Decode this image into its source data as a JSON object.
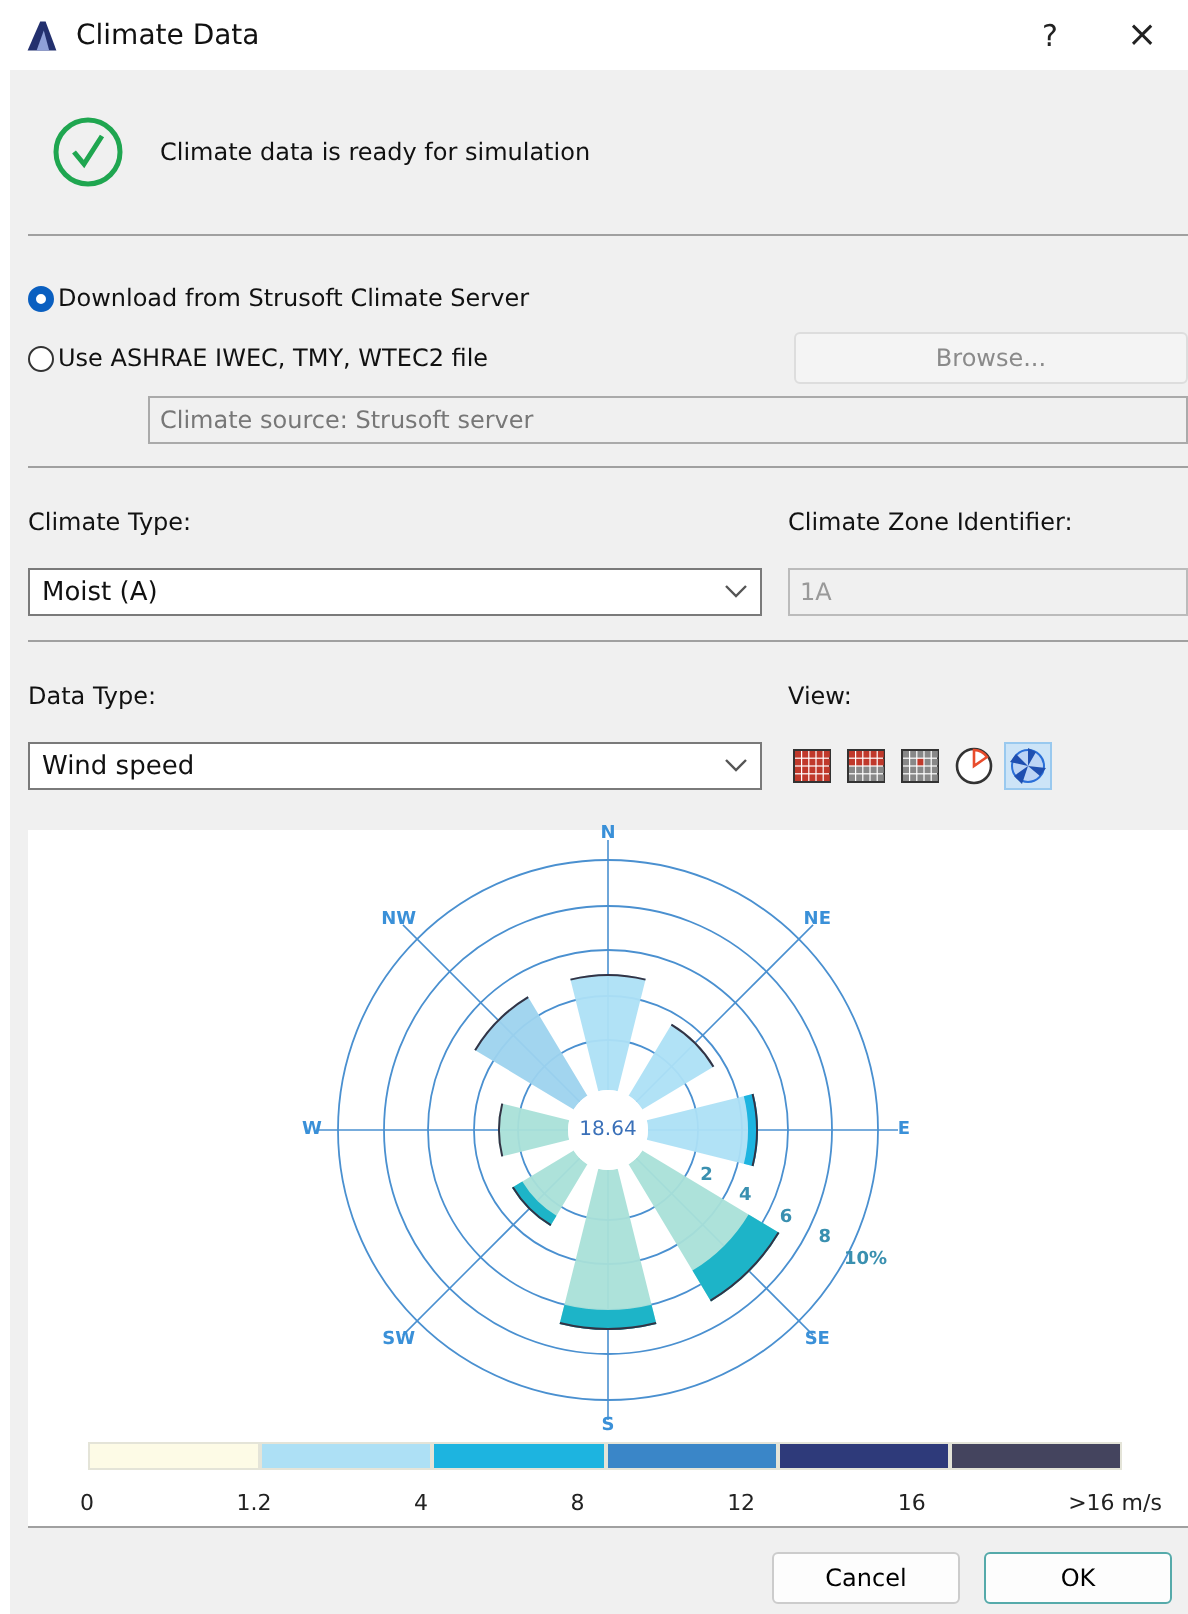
{
  "window": {
    "title": "Climate Data",
    "help": "?",
    "close": "×"
  },
  "status": {
    "message": "Climate data is ready for simulation",
    "ok": true
  },
  "source_options": [
    {
      "label": "Download from Strusoft Climate Server",
      "selected": true
    },
    {
      "label": "Use ASHRAE IWEC, TMY, WTEC2 file",
      "selected": false
    }
  ],
  "browse_button": {
    "label": "Browse...",
    "disabled": true
  },
  "source_field": {
    "value": "Climate source: Strusoft server"
  },
  "climate_type": {
    "label": "Climate Type:",
    "value": "Moist (A)"
  },
  "zone": {
    "label": "Climate Zone Identifier:",
    "value": "1A"
  },
  "data_type": {
    "label": "Data Type:",
    "value": "Wind speed"
  },
  "view": {
    "label": "View:",
    "options": [
      {
        "kind": "grid-full",
        "selected": false
      },
      {
        "kind": "grid-half",
        "selected": false
      },
      {
        "kind": "grid-dot",
        "selected": false
      },
      {
        "kind": "clock",
        "selected": false
      },
      {
        "kind": "rose",
        "selected": true
      }
    ]
  },
  "wind_rose": {
    "directions": [
      "N",
      "NE",
      "E",
      "SE",
      "S",
      "SW",
      "W",
      "NW"
    ],
    "center_value": "18.64",
    "ring_labels": [
      "2",
      "4",
      "6",
      "8",
      "10%"
    ]
  },
  "legend": {
    "segments": [
      {
        "color": "#fdfbe6"
      },
      {
        "color": "#ade0f5"
      },
      {
        "color": "#1db4e0"
      },
      {
        "color": "#3a86c8"
      },
      {
        "color": "#2e3a7a"
      },
      {
        "color": "#44445e"
      }
    ],
    "ticks": [
      "0",
      "1.2",
      "4",
      "8",
      "12",
      "16",
      ">16 m/s"
    ]
  },
  "buttons": [
    {
      "label": "Cancel",
      "default": false
    },
    {
      "label": "OK",
      "default": true
    }
  ]
}
